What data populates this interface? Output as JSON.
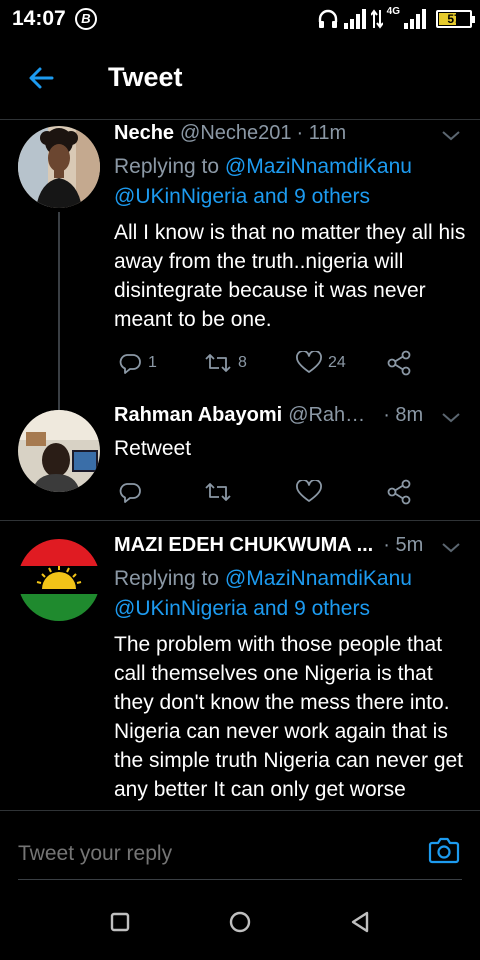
{
  "statusbar": {
    "time": "14:07",
    "b_icon_label": "B",
    "network_label": "4G",
    "battery": "57",
    "battery_fraction": 0.57,
    "battery_color": "#e6cb2d"
  },
  "header": {
    "title": "Tweet"
  },
  "colors": {
    "link": "#1d9bf0",
    "muted": "#8b98a5",
    "divider": "#2f3336"
  },
  "tweets": [
    {
      "name": "Neche",
      "handle": "@Neche201",
      "time": "· 11m",
      "replying_prefix": "Replying to ",
      "replying_mentions_1": "@MaziNnamdiKanu",
      "replying_mentions_2": "@UKinNigeria and 9 others",
      "text": "All I know is that no matter they all his away from the truth..nigeria will disintegrate because it was never meant to be one.",
      "reply_count": "1",
      "retweet_count": "8",
      "like_count": "24"
    },
    {
      "name": "Rahman Abayomi",
      "handle": "@Rah…",
      "time": "· 8m",
      "text": "Retweet",
      "reply_count": "",
      "retweet_count": "",
      "like_count": ""
    },
    {
      "name": "MAZI EDEH CHUKWUMA ...",
      "handle": "",
      "time": "· 5m",
      "replying_prefix": "Replying to ",
      "replying_mentions_1": "@MaziNnamdiKanu",
      "replying_mentions_2": "@UKinNigeria and 9 others",
      "text": "The problem with those people that call themselves one Nigeria is that they don't know the mess there into. Nigeria can never work again that is the simple truth Nigeria can never get any better It can only get worse"
    }
  ],
  "composer": {
    "placeholder": "Tweet your reply"
  },
  "icons": {
    "back": "arrow-left-icon",
    "caret": "chevron-down-icon",
    "reply": "reply-icon",
    "retweet": "retweet-icon",
    "like": "heart-icon",
    "share": "share-icon",
    "camera": "camera-icon",
    "nav_recent": "square-icon",
    "nav_home": "circle-icon",
    "nav_back": "triangle-icon"
  }
}
